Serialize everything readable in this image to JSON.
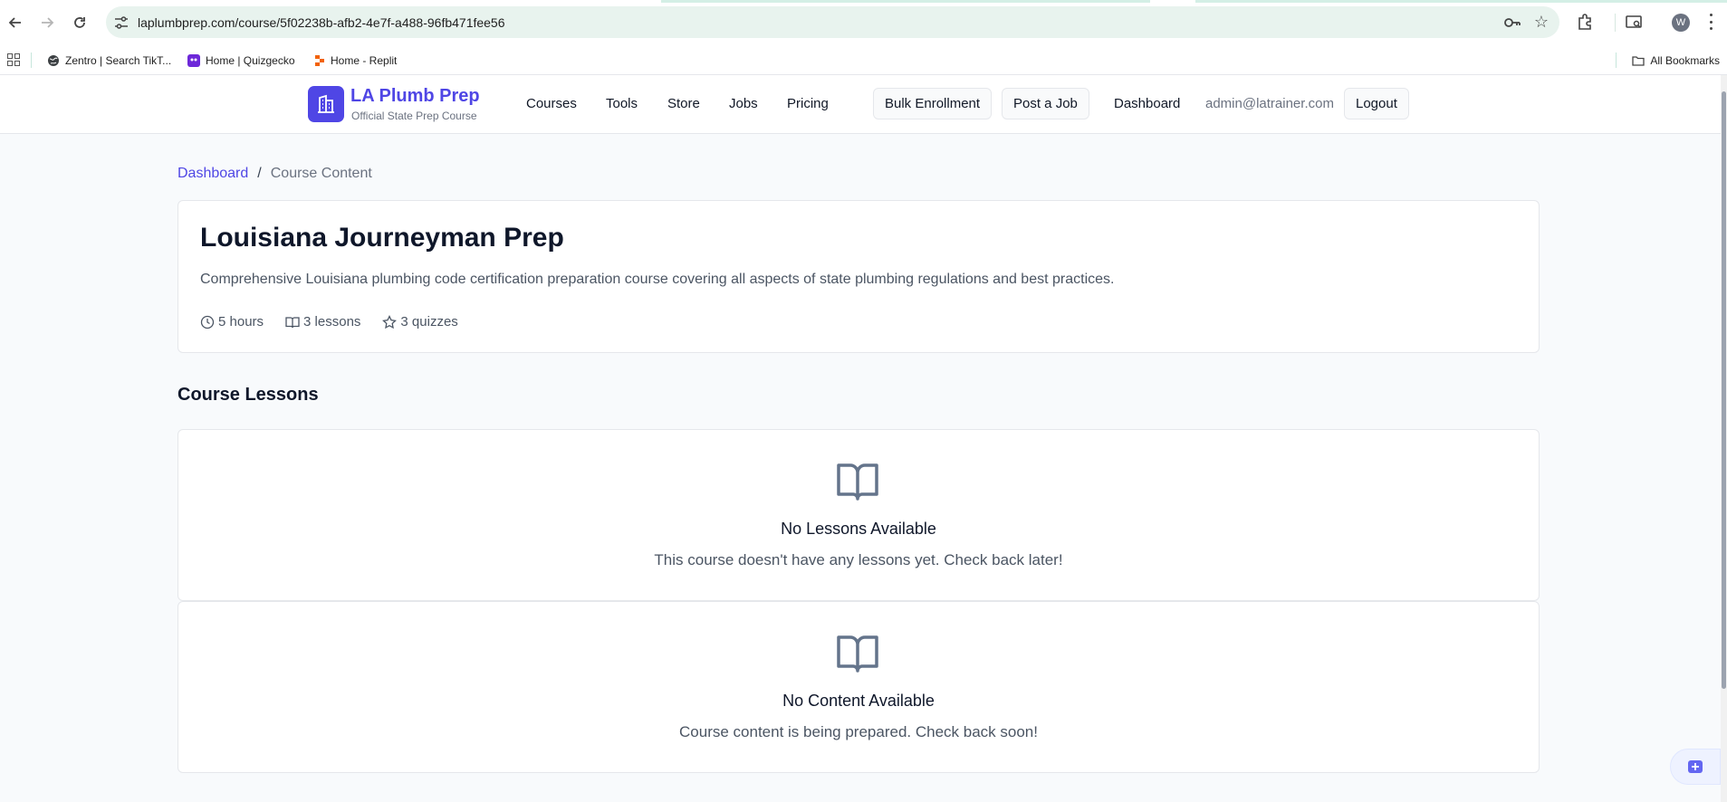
{
  "browser": {
    "url": "laplumbprep.com/course/5f02238b-afb2-4e7f-a488-96fb471fee56",
    "profile_initial": "W",
    "bookmarks": [
      {
        "label": "Zentro | Search TikT..."
      },
      {
        "label": "Home | Quizgecko"
      },
      {
        "label": "Home - Replit"
      }
    ],
    "all_bookmarks_label": "All Bookmarks"
  },
  "header": {
    "brand_name": "LA Plumb Prep",
    "brand_tagline": "Official State Prep Course",
    "nav": {
      "courses": "Courses",
      "tools": "Tools",
      "store": "Store",
      "jobs": "Jobs",
      "pricing": "Pricing"
    },
    "bulk_enrollment": "Bulk Enrollment",
    "post_job": "Post a Job",
    "dashboard": "Dashboard",
    "user_email": "admin@latrainer.com",
    "logout": "Logout"
  },
  "breadcrumb": {
    "home": "Dashboard",
    "separator": "/",
    "current": "Course Content"
  },
  "course": {
    "title": "Louisiana Journeyman Prep",
    "description": "Comprehensive Louisiana plumbing code certification preparation course covering all aspects of state plumbing regulations and best practices.",
    "duration": "5 hours",
    "lessons": "3 lessons",
    "quizzes": "3 quizzes"
  },
  "lessons_section": {
    "title": "Course Lessons"
  },
  "empty_lessons": {
    "title": "No Lessons Available",
    "text": "This course doesn't have any lessons yet. Check back later!"
  },
  "empty_content": {
    "title": "No Content Available",
    "text": "Course content is being prepared. Check back soon!"
  }
}
